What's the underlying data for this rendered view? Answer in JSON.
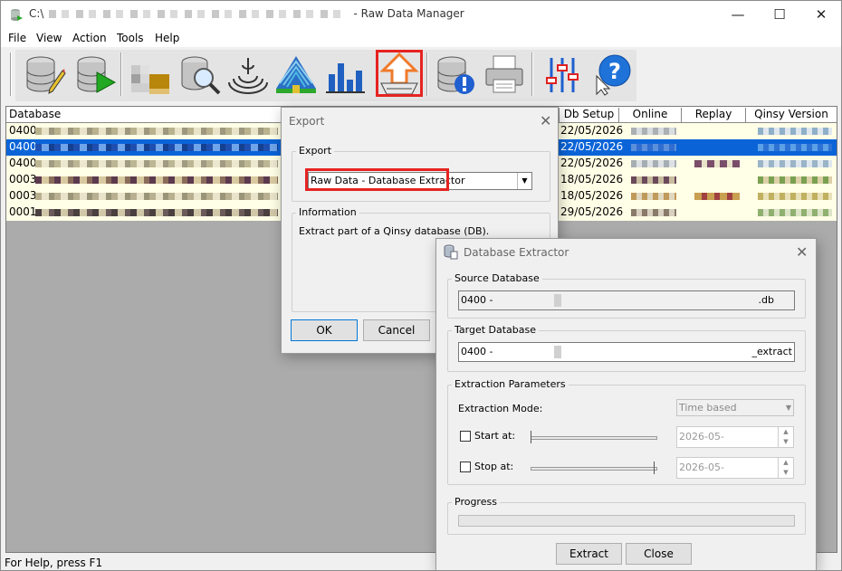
{
  "window": {
    "title_prefix": "C:\\",
    "title_suffix": "- Raw Data Manager",
    "minimize_glyph": "—",
    "maximize_glyph": "☐",
    "close_glyph": "✕"
  },
  "menu": [
    "File",
    "View",
    "Action",
    "Tools",
    "Help"
  ],
  "toolbar": {
    "buttons": [
      "edit-database-icon",
      "replay-database-icon",
      "import-icon",
      "search-database-icon",
      "signal-icon",
      "survey-icon",
      "chart-icon",
      "export-icon",
      "database-info-icon",
      "print-icon",
      "settings-icon",
      "help-pointer-icon"
    ]
  },
  "grid": {
    "columns": [
      "Database",
      "Db Setup",
      "Online",
      "Replay",
      "Qinsy Version"
    ],
    "rows": [
      {
        "db": "0400",
        "setup": "22/05/2026"
      },
      {
        "db": "0400",
        "setup": "22/05/2026"
      },
      {
        "db": "0400",
        "setup": "22/05/2026"
      },
      {
        "db": "0003",
        "setup": "18/05/2026"
      },
      {
        "db": "0003",
        "setup": "18/05/2026"
      },
      {
        "db": "0001",
        "setup": "29/05/2026"
      }
    ]
  },
  "status": "For Help, press F1",
  "export_dialog": {
    "title": "Export",
    "close_glyph": "✕",
    "export_group": "Export",
    "selected": "Raw Data - Database Extractor",
    "info_group": "Information",
    "info_text": "Extract part of a Qinsy database (DB).",
    "ok": "OK",
    "cancel": "Cancel"
  },
  "extractor": {
    "title": "Database Extractor",
    "close_glyph": "✕",
    "source_group": "Source Database",
    "source_prefix": "0400 -",
    "source_suffix": ".db",
    "target_group": "Target Database",
    "target_prefix": "0400 -",
    "target_suffix": "_extract",
    "params_group": "Extraction Parameters",
    "mode_label": "Extraction Mode:",
    "mode_value": "Time based",
    "start_label": "Start at:",
    "start_value": "2026-05-",
    "stop_label": "Stop at:",
    "stop_value": "2026-05-",
    "progress_group": "Progress",
    "progress": 0,
    "extract": "Extract",
    "close": "Close"
  }
}
